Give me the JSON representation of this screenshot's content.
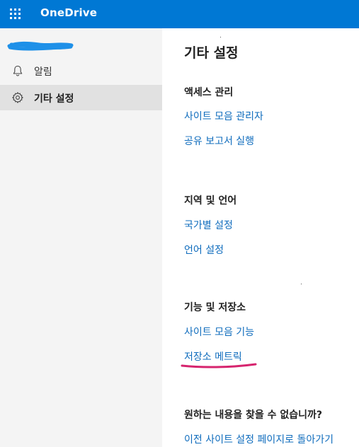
{
  "app": {
    "title": "OneDrive"
  },
  "nav": {
    "items": [
      {
        "label": "알림",
        "icon": "bell-icon",
        "selected": false
      },
      {
        "label": "기타 설정",
        "icon": "gear-icon",
        "selected": true
      }
    ]
  },
  "main": {
    "title": "기타 설정",
    "sections": [
      {
        "heading": "액세스 관리",
        "links": [
          "사이트 모음 관리자",
          "공유 보고서 실행"
        ]
      },
      {
        "heading": "지역 및 언어",
        "links": [
          "국가별 설정",
          "언어 설정"
        ]
      },
      {
        "heading": "기능 및 저장소",
        "links": [
          "사이트 모음 기능",
          "저장소 메트릭"
        ]
      }
    ],
    "help": {
      "heading": "원하는 내용을 찾을 수 없습니까?",
      "link": "이전 사이트 설정 페이지로 돌아가기"
    }
  },
  "colors": {
    "topbar": "#0078d4",
    "link": "#0f6cbd",
    "nav_bg": "#f4f4f4",
    "nav_selected": "#e1e1e1",
    "redaction": "#1e90e8",
    "annotation": "#d6246e"
  }
}
